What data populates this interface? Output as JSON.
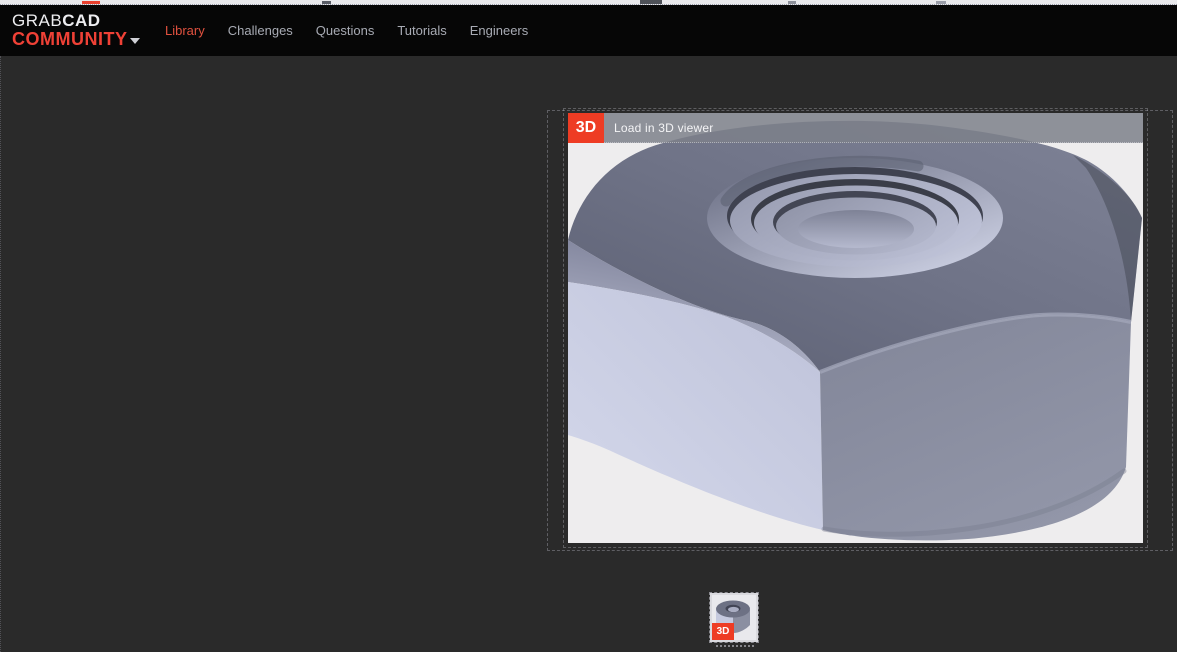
{
  "colors": {
    "brand_red": "#ef4136",
    "badge_red": "#ee3c24",
    "active_link_red": "#e0513f",
    "nav_link_gray": "#a8abb4",
    "navbar_bg": "#060606",
    "page_bg": "#2a2a2a",
    "viewer_bg": "#eeedee"
  },
  "navbar": {
    "logo": {
      "line1_regular": "GRAB",
      "line1_bold": "CAD",
      "line2": "COMMUNITY"
    },
    "items": [
      {
        "label": "Library",
        "active": true
      },
      {
        "label": "Challenges",
        "active": false
      },
      {
        "label": "Questions",
        "active": false
      },
      {
        "label": "Tutorials",
        "active": false
      },
      {
        "label": "Engineers",
        "active": false
      }
    ]
  },
  "viewer": {
    "badge_label": "3D",
    "header_label": "Load in 3D viewer",
    "content": "hex-nut-3d-model-preview"
  },
  "thumbnail": {
    "badge_label": "3D"
  }
}
